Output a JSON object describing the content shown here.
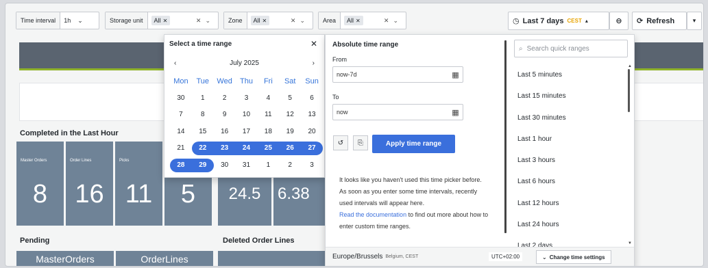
{
  "variables": [
    {
      "label": "Time interval",
      "value": "1h",
      "chips": []
    },
    {
      "label": "Storage unit",
      "value": "",
      "chips": [
        "All"
      ]
    },
    {
      "label": "Zone",
      "value": "",
      "chips": [
        "All"
      ]
    },
    {
      "label": "Area",
      "value": "",
      "chips": [
        "All"
      ]
    }
  ],
  "toolbar": {
    "time_range_label": "Last 7 days",
    "timezone_badge": "CEST",
    "refresh_label": "Refresh"
  },
  "dashboard": {
    "completed_title": "Completed in the Last Hour",
    "tiles": [
      {
        "label": "Master Orders",
        "value": "8"
      },
      {
        "label": "Order Lines",
        "value": "16"
      },
      {
        "label": "Picks",
        "value": "11"
      },
      {
        "label": "",
        "value": "5"
      },
      {
        "label": "",
        "value": "24.5"
      },
      {
        "label": "",
        "value": "6.38"
      }
    ],
    "pending_title": "Pending",
    "deleted_title": "Deleted Order Lines",
    "bottom_tiles": [
      "MasterOrders",
      "OrderLines"
    ]
  },
  "calendar": {
    "title": "Select a time range",
    "month": "July 2025",
    "weekdays": [
      "Mon",
      "Tue",
      "Wed",
      "Thu",
      "Fri",
      "Sat",
      "Sun"
    ],
    "weeks": [
      [
        "30",
        "1",
        "2",
        "3",
        "4",
        "5",
        "6"
      ],
      [
        "7",
        "8",
        "9",
        "10",
        "11",
        "12",
        "13"
      ],
      [
        "14",
        "15",
        "16",
        "17",
        "18",
        "19",
        "20"
      ],
      [
        "21",
        "22",
        "23",
        "24",
        "25",
        "26",
        "27"
      ],
      [
        "28",
        "29",
        "30",
        "31",
        "1",
        "2",
        "3"
      ]
    ],
    "selected_range": [
      "22",
      "29"
    ]
  },
  "absolute": {
    "title": "Absolute time range",
    "from_label": "From",
    "from_value": "now-7d",
    "to_label": "To",
    "to_value": "now",
    "apply_label": "Apply time range",
    "info_text": "It looks like you haven't used this time picker before. As soon as you enter some time intervals, recently used intervals will appear here.",
    "info_link": "Read the documentation",
    "info_suffix": "to find out more about how to enter custom time ranges."
  },
  "quick": {
    "search_placeholder": "Search quick ranges",
    "items": [
      "Last 5 minutes",
      "Last 15 minutes",
      "Last 30 minutes",
      "Last 1 hour",
      "Last 3 hours",
      "Last 6 hours",
      "Last 12 hours",
      "Last 24 hours",
      "Last 2 days"
    ]
  },
  "footer": {
    "timezone": "Europe/Brussels",
    "timezone_sub": "Belgium, CEST",
    "utc": "UTC+02:00",
    "change_label": "Change time settings"
  },
  "colors": {
    "accent": "#3a6fdc",
    "tile": "#6f8397",
    "header_bar": "#5a6470",
    "green": "#8fb32a"
  }
}
